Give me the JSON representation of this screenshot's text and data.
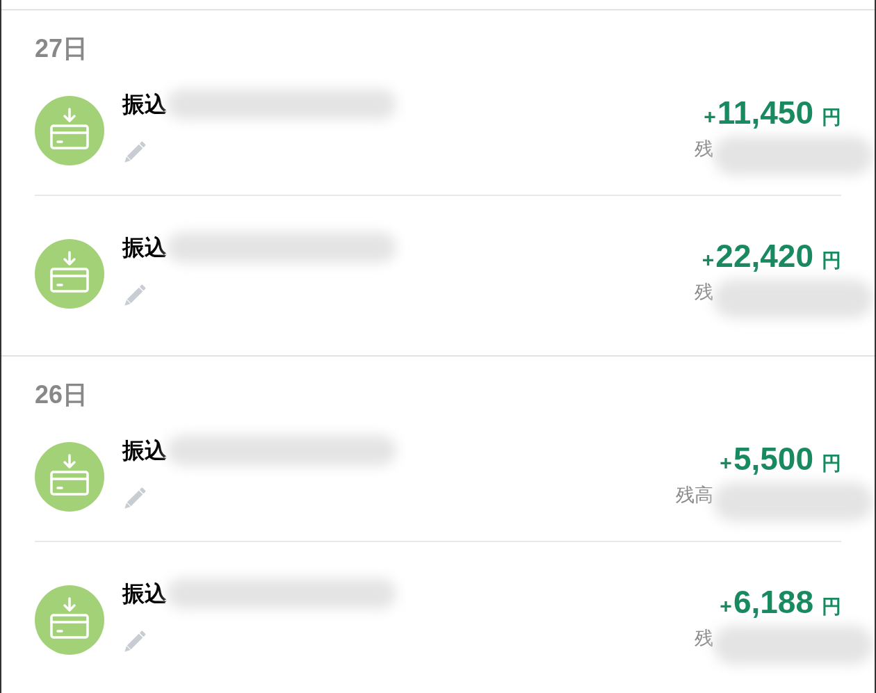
{
  "sections": [
    {
      "date": "27日",
      "transactions": [
        {
          "kind": "deposit",
          "title": "振込",
          "sign": "+",
          "amount": "11,450",
          "unit": "円",
          "balance_label": "残"
        },
        {
          "kind": "deposit",
          "title": "振込",
          "sign": "+",
          "amount": "22,420",
          "unit": "円",
          "balance_label": "残"
        }
      ]
    },
    {
      "date": "26日",
      "transactions": [
        {
          "kind": "deposit",
          "title": "振込",
          "sign": "+",
          "amount": "5,500",
          "unit": "円",
          "balance_label": "残高"
        },
        {
          "kind": "deposit",
          "title": "振込",
          "sign": "+",
          "amount": "6,188",
          "unit": "円",
          "balance_label": "残"
        }
      ]
    }
  ]
}
